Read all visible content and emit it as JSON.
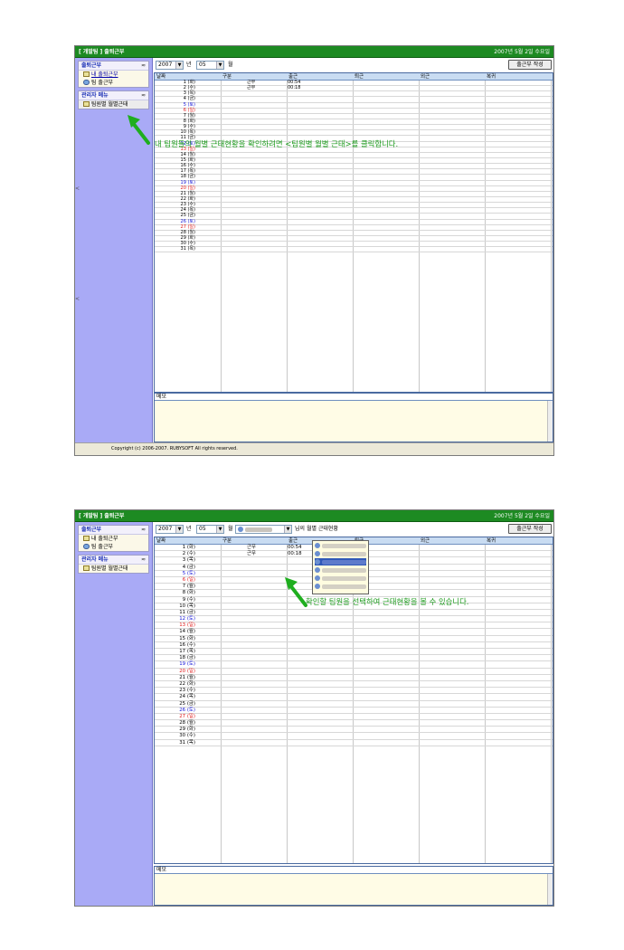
{
  "titlebar": {
    "title": "[ 개발팀 ] 출퇴근부",
    "date": "2007년 5월 2일 수요일"
  },
  "sidebar": {
    "attendance_header": "출퇴근부",
    "attendance_items": [
      "내 출퇴근부",
      "팀 출근부"
    ],
    "admin_header": "관리자 메뉴",
    "admin_items": [
      "팀원별 월별근태"
    ],
    "collapse_symbol": "≈"
  },
  "toolbar": {
    "year": "2007",
    "year_suffix": "년",
    "month": "05",
    "month_suffix": "월",
    "member_suffix": "님의 월별 근태현황",
    "write_button": "출근부 작성",
    "arrow": "▼"
  },
  "grid": {
    "columns": [
      "날짜",
      "구분",
      "출근",
      "퇴근",
      "외근",
      "복귀"
    ],
    "rows": [
      {
        "date": "1 (화)",
        "kind": "weekday",
        "type": "근무",
        "in": "00:54"
      },
      {
        "date": "2 (수)",
        "kind": "weekday",
        "type": "근무",
        "in": "00:18"
      },
      {
        "date": "3 (목)",
        "kind": "weekday"
      },
      {
        "date": "4 (금)",
        "kind": "weekday"
      },
      {
        "date": "5 (토)",
        "kind": "sat"
      },
      {
        "date": "6 (일)",
        "kind": "sun"
      },
      {
        "date": "7 (월)",
        "kind": "weekday"
      },
      {
        "date": "8 (화)",
        "kind": "weekday"
      },
      {
        "date": "9 (수)",
        "kind": "weekday"
      },
      {
        "date": "10 (목)",
        "kind": "weekday"
      },
      {
        "date": "11 (금)",
        "kind": "weekday"
      },
      {
        "date": "12 (토)",
        "kind": "sat"
      },
      {
        "date": "13 (일)",
        "kind": "sun"
      },
      {
        "date": "14 (월)",
        "kind": "weekday"
      },
      {
        "date": "15 (화)",
        "kind": "weekday"
      },
      {
        "date": "16 (수)",
        "kind": "weekday"
      },
      {
        "date": "17 (목)",
        "kind": "weekday"
      },
      {
        "date": "18 (금)",
        "kind": "weekday"
      },
      {
        "date": "19 (토)",
        "kind": "sat"
      },
      {
        "date": "20 (일)",
        "kind": "sun"
      },
      {
        "date": "21 (월)",
        "kind": "weekday"
      },
      {
        "date": "22 (화)",
        "kind": "weekday"
      },
      {
        "date": "23 (수)",
        "kind": "weekday"
      },
      {
        "date": "24 (목)",
        "kind": "weekday"
      },
      {
        "date": "25 (금)",
        "kind": "weekday"
      },
      {
        "date": "26 (토)",
        "kind": "sat"
      },
      {
        "date": "27 (일)",
        "kind": "sun"
      },
      {
        "date": "28 (월)",
        "kind": "weekday"
      },
      {
        "date": "29 (화)",
        "kind": "weekday"
      },
      {
        "date": "30 (수)",
        "kind": "weekday"
      },
      {
        "date": "31 (목)",
        "kind": "weekday"
      }
    ]
  },
  "memo_label": "메모",
  "status_bar": "Copyright (c) 2006-2007. RUBYSOFT All rights reserved.",
  "annotations": {
    "first": "내 팀원들의 월별 근태현황을 확인하려면 <팀원별 월별 근태>를 클릭합니다.",
    "second": "확인할 팀원을 선택하여 근태현황을 볼 수 있습니다."
  },
  "colors": {
    "titlebar": "#1d8a22",
    "sidebar": "#a9aaf6",
    "annotation": "#1c9a1c",
    "saturday": "#1212d8",
    "sunday": "#e01818",
    "memo": "#fffce6"
  },
  "edge_mark": "<"
}
